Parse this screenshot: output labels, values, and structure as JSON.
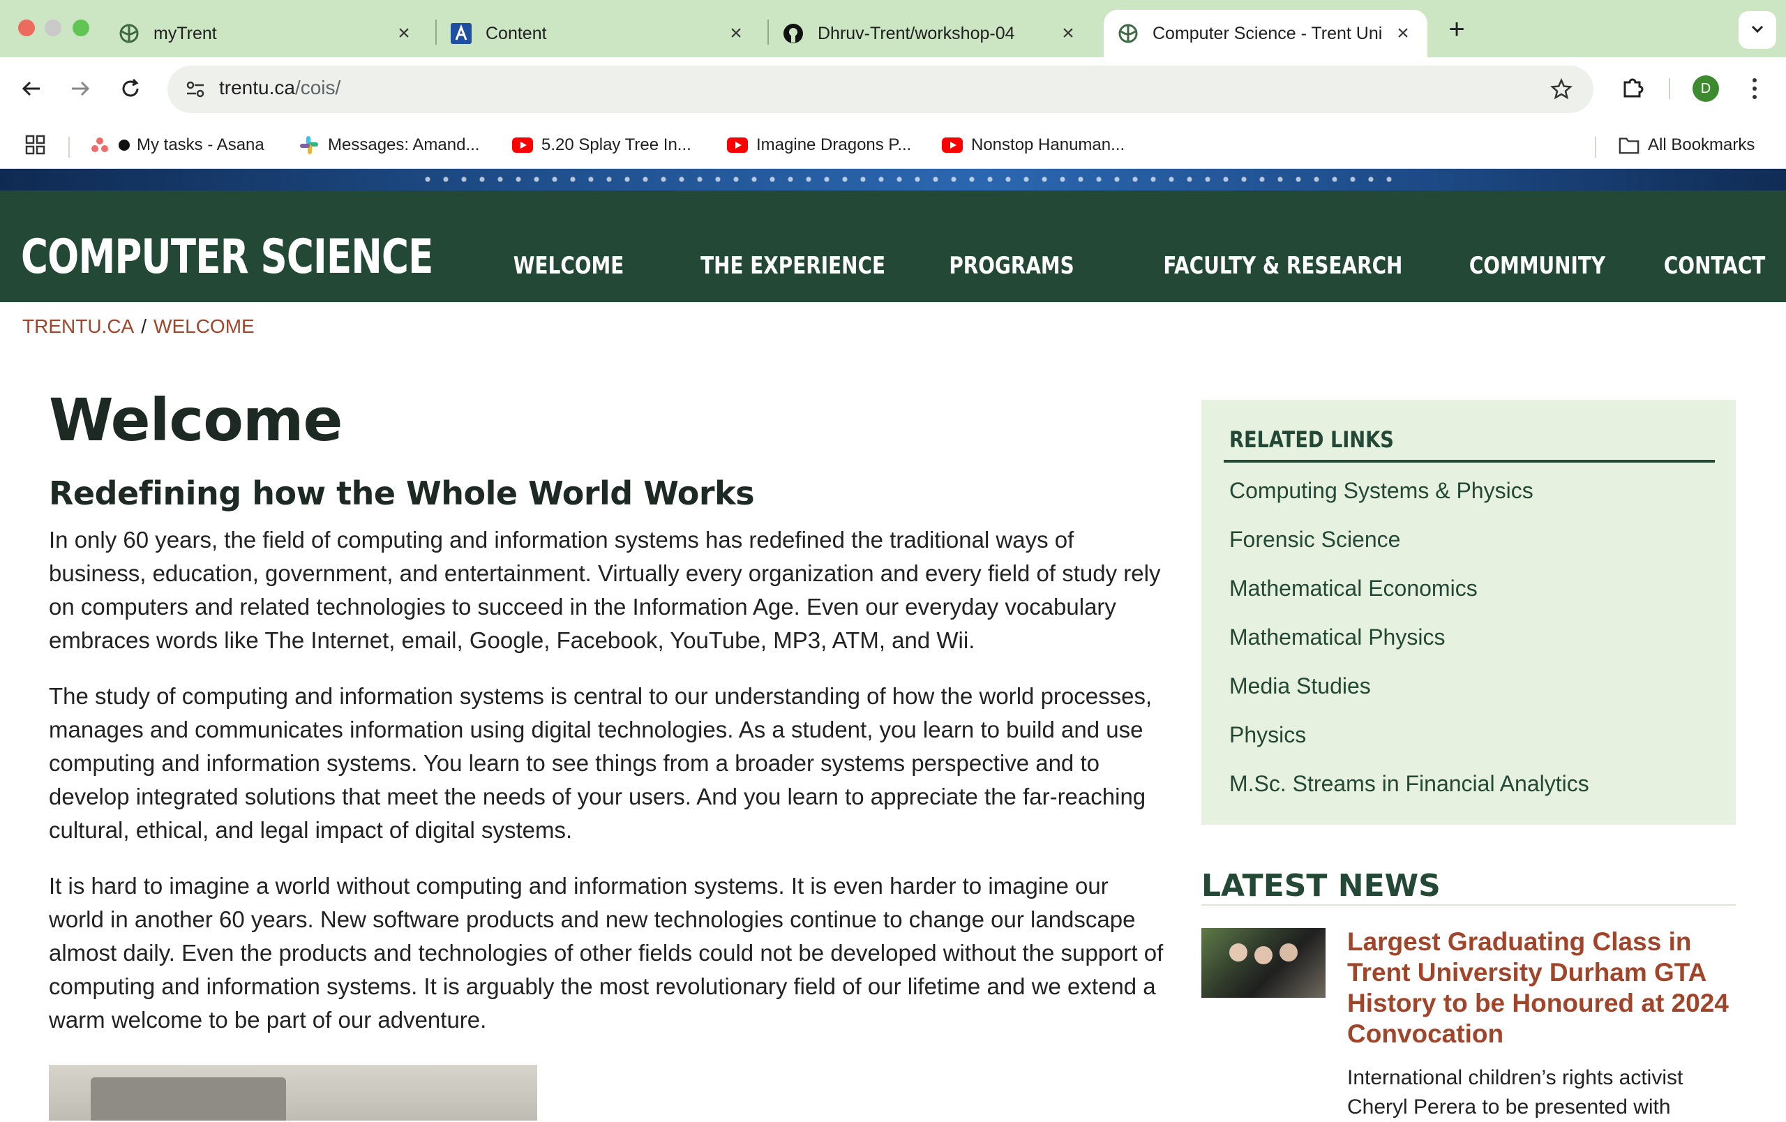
{
  "browser": {
    "tabs": [
      {
        "label": "myTrent",
        "icon": "trent-logo-icon"
      },
      {
        "label": "Content",
        "icon": "content-a-icon"
      },
      {
        "label": "Dhruv-Trent/workshop-04",
        "icon": "github-icon"
      },
      {
        "label": "Computer Science - Trent Uni",
        "icon": "trent-logo-icon",
        "active": true
      }
    ],
    "url_host": "trentu.ca",
    "url_path": "/cois/",
    "profile_initial": "D",
    "bookmarks": [
      {
        "label": "My tasks - Asana",
        "icon": "asana-icon"
      },
      {
        "label": "Messages: Amand...",
        "icon": "slack-icon"
      },
      {
        "label": "5.20 Splay Tree In...",
        "icon": "youtube-icon"
      },
      {
        "label": "Imagine Dragons P...",
        "icon": "youtube-icon"
      },
      {
        "label": "Nonstop Hanuman...",
        "icon": "youtube-icon"
      }
    ],
    "all_bookmarks": "All Bookmarks"
  },
  "site": {
    "title": "COMPUTER SCIENCE",
    "nav": [
      "WELCOME",
      "THE EXPERIENCE",
      "PROGRAMS",
      "FACULTY & RESEARCH",
      "COMMUNITY",
      "CONTACT"
    ],
    "breadcrumb": [
      "TRENTU.CA",
      "/",
      "WELCOME"
    ]
  },
  "main": {
    "title": "Welcome",
    "subtitle": "Redefining how the Whole World Works",
    "paragraphs": [
      "In only 60 years, the field of computing and information systems has redefined the traditional ways of business, education, government, and entertainment.  Virtually every organization and every field of study rely on computers and related technologies to succeed in the Information Age.  Even our everyday vocabulary embraces words like The Internet, email, Google, Facebook, YouTube, MP3, ATM, and Wii.",
      "The study of computing and information systems is central to our understanding of how the world processes, manages and communicates information using digital technologies.  As a student, you learn to build and use computing and information systems.  You learn to see things from a broader systems perspective and to develop integrated solutions that meet the needs of your users.  And you learn to appreciate the far-reaching cultural, ethical, and legal impact of digital systems.",
      "It is hard to imagine a world without computing and information systems.  It is even harder to imagine our world in another 60 years.  New software products and new technologies continue to change our landscape almost daily.  Even the products and technologies of other fields could not be developed without the support of computing and information systems.  It is arguably the most revolutionary field of our lifetime and we extend a warm welcome to be part of our adventure."
    ]
  },
  "sidebar": {
    "heading": "RELATED LINKS",
    "links": [
      "Computing Systems & Physics",
      "Forensic Science",
      "Mathematical Economics",
      "Mathematical Physics",
      "Media Studies",
      "Physics",
      "M.Sc. Streams in Financial Analytics"
    ]
  },
  "news": {
    "heading": "LATEST NEWS",
    "items": [
      {
        "title": "Largest Graduating Class in Trent University Durham GTA History to be Honoured at 2024 Convocation",
        "desc": "International children’s rights activist Cheryl Perera to be presented with"
      }
    ]
  },
  "colors": {
    "tab_strip": "#cce5c3",
    "header_green": "#234836",
    "link_rust": "#a0442a",
    "sidebar_bg": "#e7f1df"
  }
}
